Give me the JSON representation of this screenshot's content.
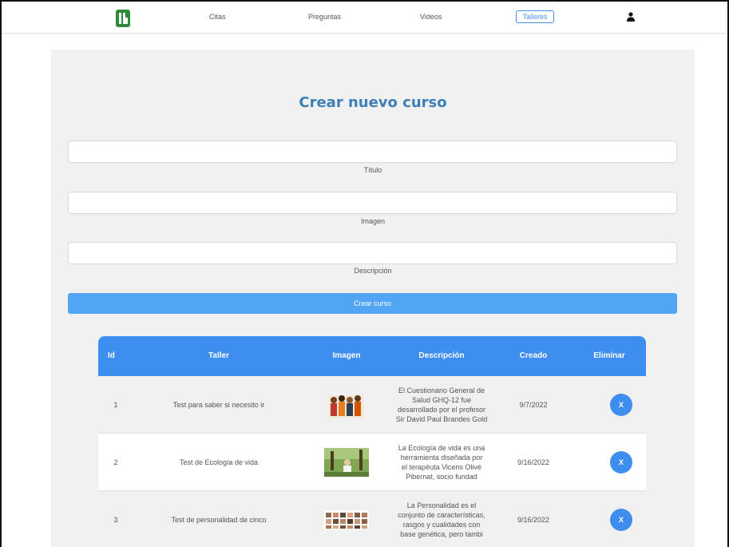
{
  "nav": {
    "items": [
      "Citas",
      "Preguntas",
      "Videos"
    ],
    "active": "Talleres"
  },
  "form": {
    "title": "Crear nuevo curso",
    "fields": [
      {
        "label": "Título",
        "value": ""
      },
      {
        "label": "Imagen",
        "value": ""
      },
      {
        "label": "Descripción",
        "value": ""
      }
    ],
    "submit_label": "Crear curso"
  },
  "table": {
    "headers": [
      "Id",
      "Taller",
      "Imagen",
      "Descripción",
      "Creado",
      "Eliminar"
    ],
    "rows": [
      {
        "id": "1",
        "taller": "Test para saber si necesito ir",
        "image_icon": "people-group-image",
        "descripcion": [
          "El Cuestionario General de",
          "Salud GHQ-12 fue",
          "desarrollado por el profesor",
          "Sir David Paul Brandes Gold"
        ],
        "creado": "9/7/2022",
        "eliminar": "X"
      },
      {
        "id": "2",
        "taller": "Test de Ecología de vida",
        "image_icon": "nature-person-image",
        "descripcion": [
          "La Ecología de vida es una",
          "herramienta diseñada por",
          "el terapéuta Vicens Olivé",
          "Pibernat, socio fundad"
        ],
        "creado": "9/16/2022",
        "eliminar": "X"
      },
      {
        "id": "3",
        "taller": "Test de personalidad de cinco",
        "image_icon": "faces-grid-image",
        "descripcion": [
          "La Personalidad es el",
          "conjunto de características,",
          "rasgos y cualidades con",
          "base genética, pero tambi"
        ],
        "creado": "9/16/2022",
        "eliminar": "X"
      }
    ]
  },
  "colors": {
    "accent": "#3e8ef0",
    "title": "#3d7fb8",
    "logo": "#2e8b3a",
    "button": "#52a4f4"
  }
}
